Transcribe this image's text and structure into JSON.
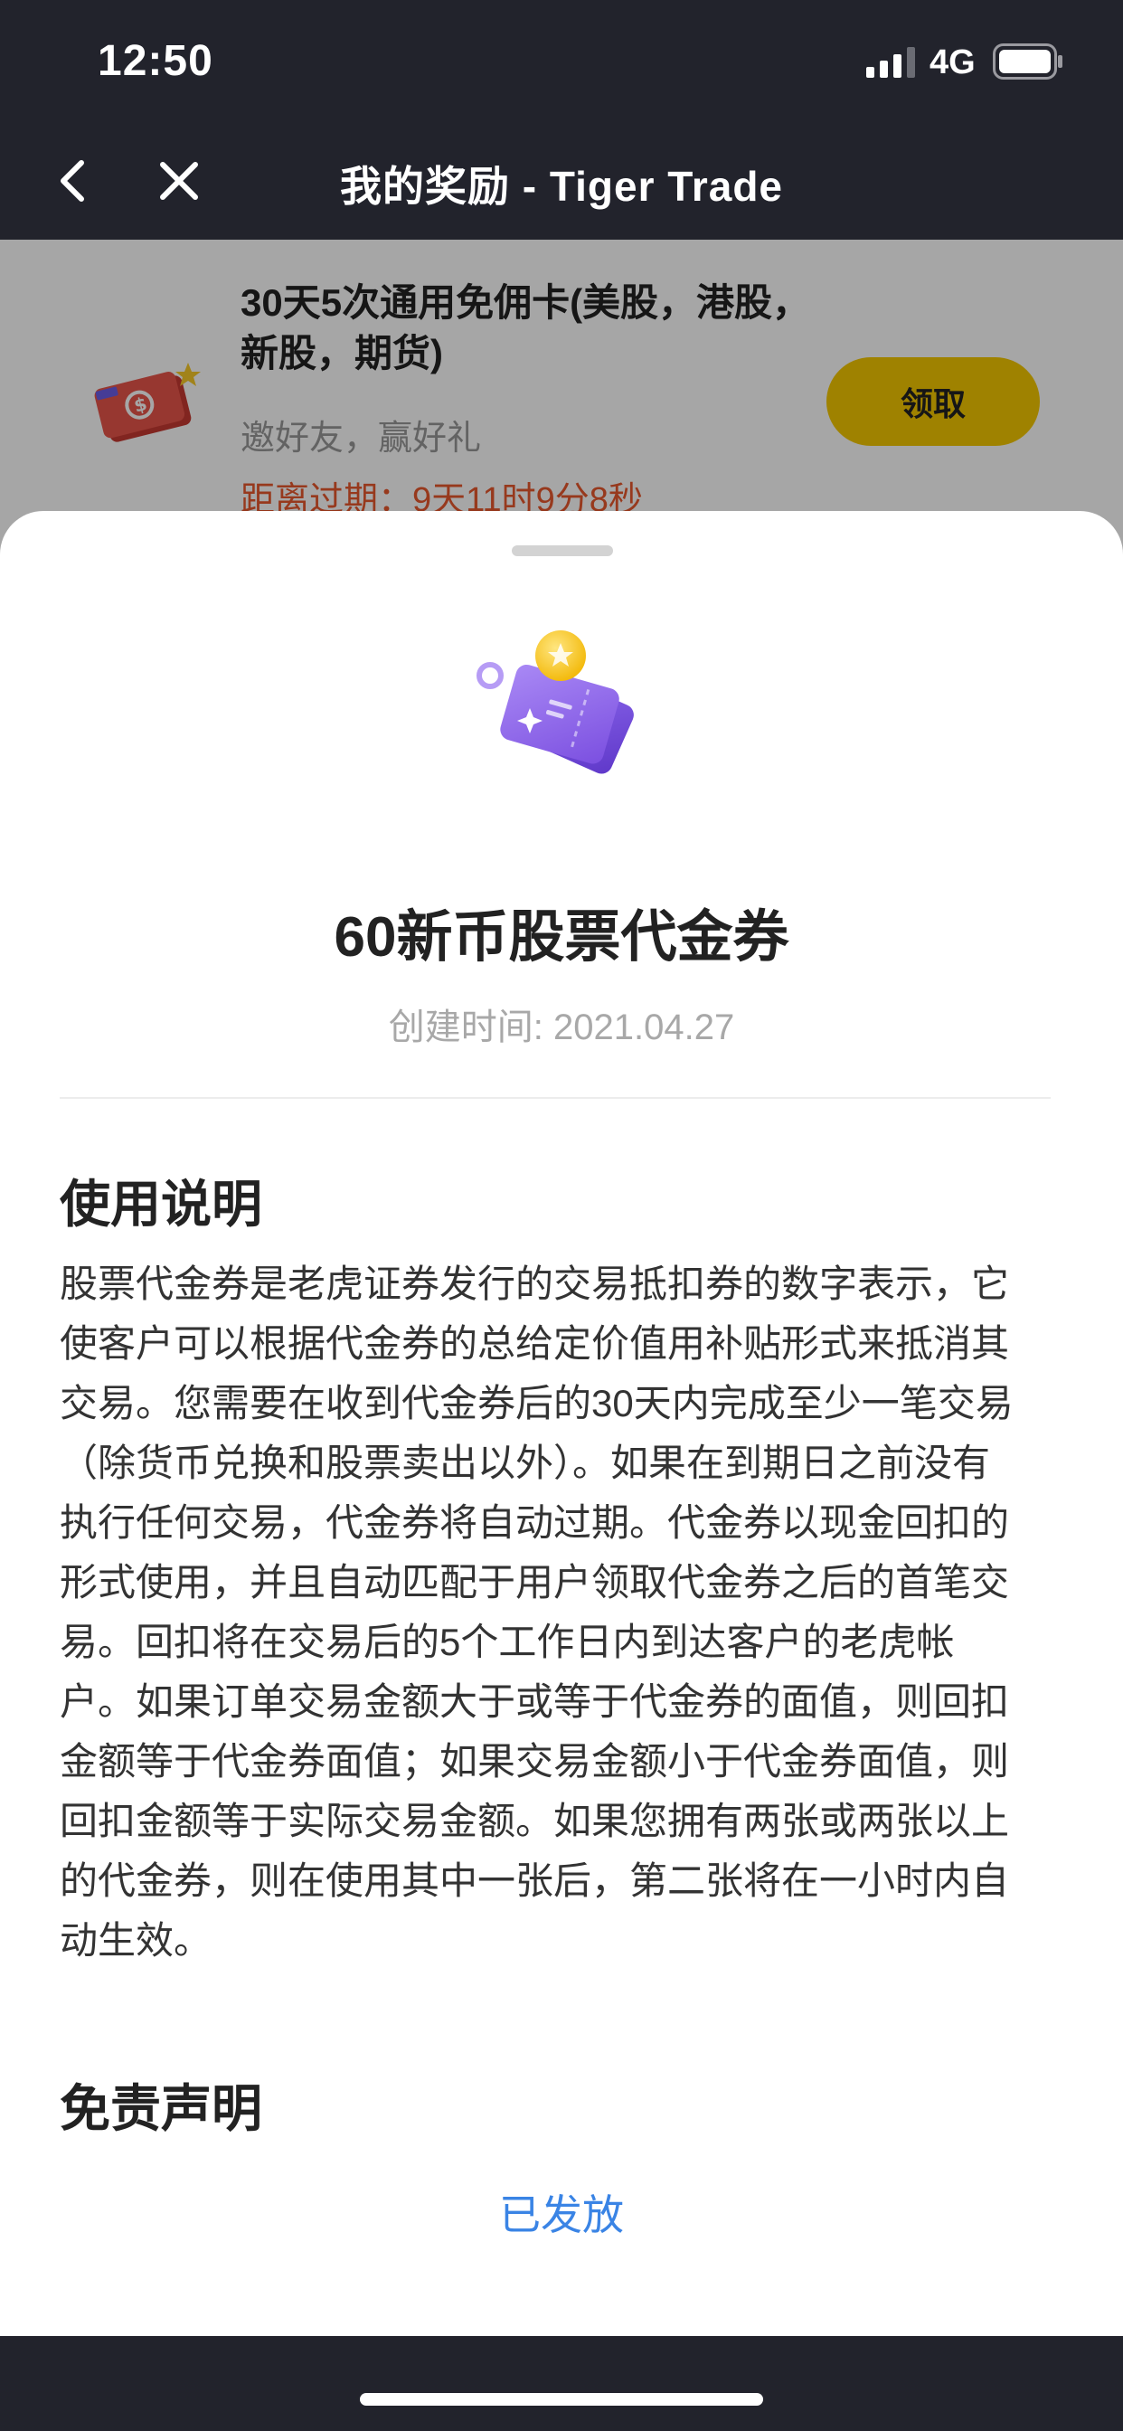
{
  "status_bar": {
    "time": "12:50",
    "network": "4G",
    "icons": [
      "signal-icon",
      "battery-icon"
    ]
  },
  "nav": {
    "title": "我的奖励 - Tiger Trade",
    "back_icon": "chevron-left-icon",
    "close_icon": "close-icon"
  },
  "background_card": {
    "title": "30天5次通用免佣卡(美股，港股，新股，期货)",
    "subtitle": "邀好友，赢好礼",
    "expiry": "距离过期：9天11时9分8秒",
    "claim_label": "领取",
    "icon": "ticket-icon"
  },
  "sheet": {
    "icon": "voucher-icon",
    "title": "60新币股票代金券",
    "created": "创建时间: 2021.04.27",
    "usage_heading": "使用说明",
    "usage_text": "股票代金券是老虎证券发行的交易抵扣券的数字表示，它使客户可以根据代金券的总给定价值用补贴形式来抵消其交易。您需要在收到代金券后的30天内完成至少一笔交易（除货币兑换和股票卖出以外）。如果在到期日之前没有执行任何交易，代金券将自动过期。代金券以现金回扣的形式使用，并且自动匹配于用户领取代金券之后的首笔交易。回扣将在交易后的5个工作日内到达客户的老虎帐户。如果订单交易金额大于或等于代金券的面值，则回扣金额等于代金券面值；如果交易金额小于代金券面值，则回扣金额等于实际交易金额。如果您拥有两张或两张以上的代金券，则在使用其中一张后，第二张将在一小时内自动生效。",
    "disclaimer_heading": "免责声明",
    "status": "已发放"
  },
  "colors": {
    "header_bg": "#22232c",
    "claim_button": "#f5c800",
    "expiry_text": "#e8582d",
    "status_link": "#3a84e5",
    "voucher_purple": "#8b5ce6"
  }
}
